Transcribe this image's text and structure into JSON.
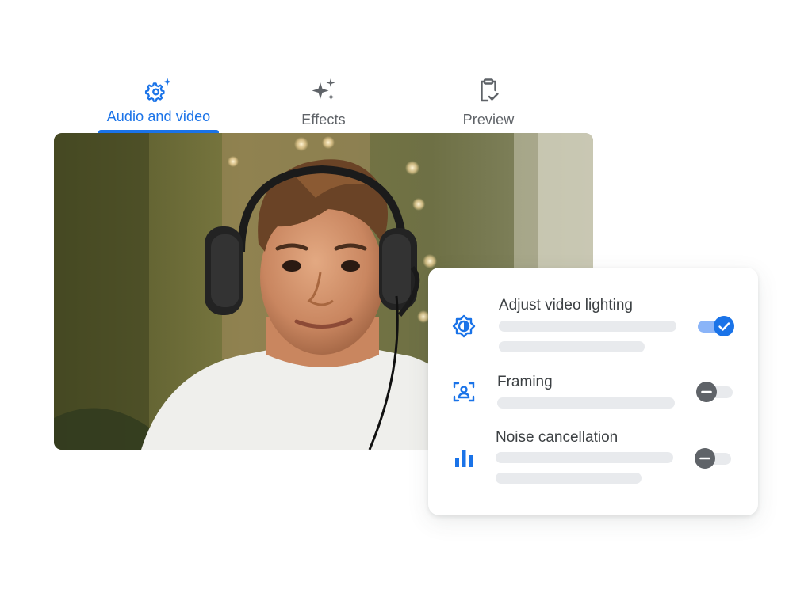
{
  "tabs": [
    {
      "label": "Audio and video",
      "icon": "settings-sparkle-icon",
      "selected": true
    },
    {
      "label": "Effects",
      "icon": "sparkles-icon",
      "selected": false
    },
    {
      "label": "Preview",
      "icon": "clipboard-check-icon",
      "selected": false
    }
  ],
  "video": {
    "content": "person-wearing-headset-photo"
  },
  "settings": {
    "items": [
      {
        "title": "Adjust video lighting",
        "icon": "brightness-icon",
        "enabled": true
      },
      {
        "title": "Framing",
        "icon": "framing-person-icon",
        "enabled": false
      },
      {
        "title": "Noise cancellation",
        "icon": "bar-chart-icon",
        "enabled": false
      }
    ]
  },
  "colors": {
    "accent": "#1a73e8",
    "accent_light": "#8ab4f8",
    "text": "#3c4043",
    "muted": "#5f6368",
    "placeholder_bar": "#e8eaed"
  }
}
